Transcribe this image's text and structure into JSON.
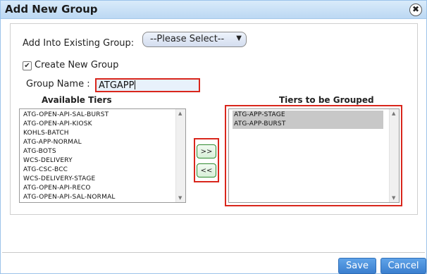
{
  "dialog": {
    "title": "Add New Group",
    "close_symbol": "✖"
  },
  "form": {
    "existing_group_label": "Add Into Existing Group:",
    "existing_group_selected": "--Please Select--",
    "create_new_group_label": "Create New Group",
    "create_new_group_checked": true,
    "group_name_label": "Group Name :",
    "group_name_value": "ATGAPP"
  },
  "available_tiers": {
    "heading": "Available Tiers",
    "items": [
      "ATG-OPEN-API-SAL-BURST",
      "ATG-OPEN-API-KIOSK",
      "KOHLS-BATCH",
      "ATG-APP-NORMAL",
      "ATG-BOTS",
      "WCS-DELIVERY",
      "ATG-CSC-BCC",
      "WCS-DELIVERY-STAGE",
      "ATG-OPEN-API-RECO",
      "ATG-OPEN-API-SAL-NORMAL"
    ]
  },
  "transfer": {
    "add_label": ">>",
    "remove_label": "<<"
  },
  "grouped_tiers": {
    "heading": "Tiers to be Grouped",
    "items": [
      "ATG-APP-STAGE",
      "ATG-APP-BURST"
    ]
  },
  "footer": {
    "save_label": "Save",
    "cancel_label": "Cancel"
  },
  "colors": {
    "highlight_border": "#d9261c",
    "primary_button": "#4a8fdc",
    "title_bar": "#cfe4f7"
  }
}
